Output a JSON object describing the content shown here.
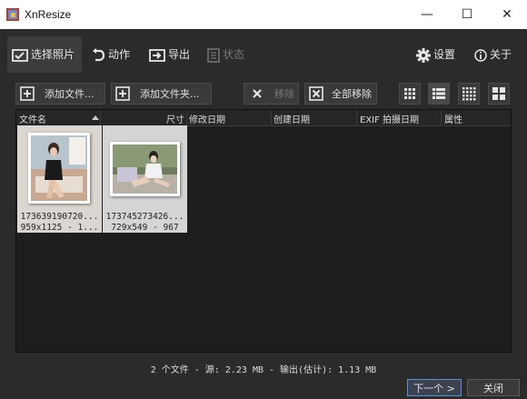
{
  "window": {
    "title": "XnResize",
    "minimize": "—",
    "maximize": "☐",
    "close": "✕"
  },
  "tabs": [
    {
      "label": "选择照片",
      "icon": "select-photos-icon",
      "active": true
    },
    {
      "label": "动作",
      "icon": "action-icon"
    },
    {
      "label": "导出",
      "icon": "export-icon"
    },
    {
      "label": "状态",
      "icon": "status-icon",
      "disabled": true
    }
  ],
  "settings": {
    "label": "设置",
    "icon": "gear-icon"
  },
  "about": {
    "label": "关于",
    "icon": "info-icon"
  },
  "buttons": {
    "add_files": "添加文件...",
    "add_folder": "添加文件夹...",
    "remove": "移除",
    "remove_all": "全部移除"
  },
  "columns": [
    "文件名",
    "尺寸",
    "修改日期",
    "创建日期",
    "EXIF 拍摄日期",
    "属性"
  ],
  "files": [
    {
      "name": "173639190720...",
      "info": "959x1125 - 1..."
    },
    {
      "name": "173745273426...",
      "info": "729x549 - 967"
    }
  ],
  "status": "2 个文件 - 源: 2.23 MB - 输出(估计): 1.13 MB",
  "footer": {
    "next": "下一个 >",
    "close": "关闭"
  },
  "colors": {
    "accent": "#5b8fd6",
    "panel_bg": "#1e1e1e",
    "window_bg": "#2b2b2b"
  }
}
